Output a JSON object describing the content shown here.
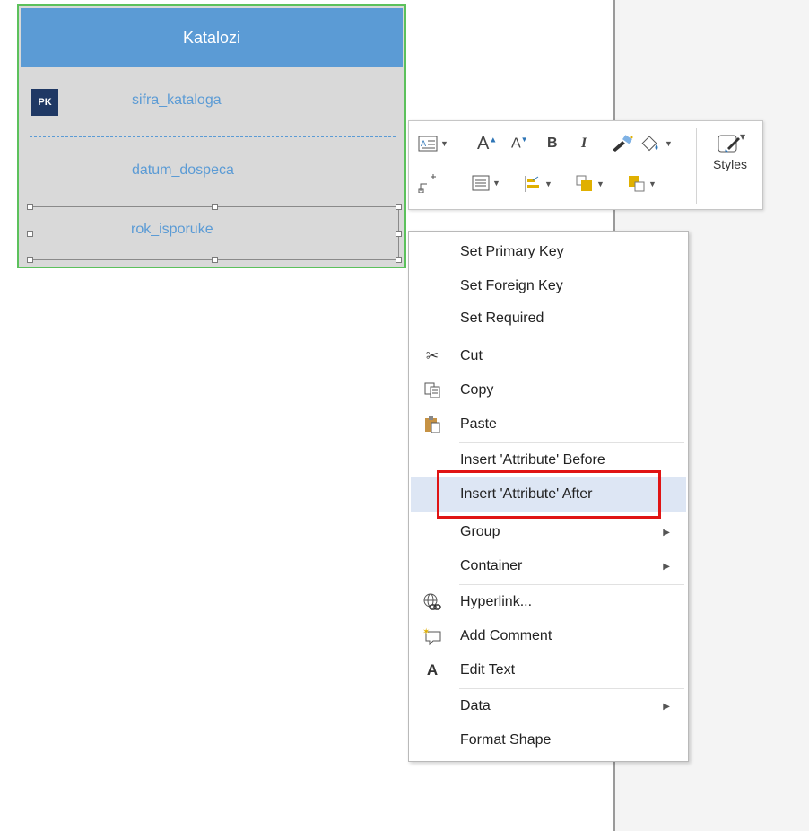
{
  "entity": {
    "title": "Katalozi",
    "pk_badge": "PK",
    "attributes": [
      "sifra_kataloga",
      "datum_dospeca",
      "rok_isporuke"
    ]
  },
  "toolbar": {
    "styles_label": "Styles"
  },
  "context_menu": {
    "items": [
      {
        "label": "Set Primary Key"
      },
      {
        "label": "Set Foreign Key"
      },
      {
        "label": "Set Required"
      },
      {
        "label": "Cut",
        "icon": "scissors-icon"
      },
      {
        "label": "Copy",
        "icon": "copy-icon"
      },
      {
        "label": "Paste",
        "icon": "paste-icon"
      },
      {
        "label": "Insert 'Attribute' Before"
      },
      {
        "label": "Insert 'Attribute' After"
      },
      {
        "label": "Group",
        "has_submenu": true
      },
      {
        "label": "Container",
        "has_submenu": true
      },
      {
        "label": "Hyperlink...",
        "icon": "hyperlink-icon"
      },
      {
        "label": "Add Comment",
        "icon": "add-comment-icon"
      },
      {
        "label": "Edit Text",
        "icon": "edit-text-icon",
        "icon_glyph": "A"
      },
      {
        "label": "Data",
        "has_submenu": true
      },
      {
        "label": "Format Shape"
      }
    ],
    "highlighted_item": "Insert 'Attribute' After"
  },
  "colors": {
    "entity_header": "#5b9bd5",
    "attribute_text": "#5b9bd5",
    "pk_badge": "#1f3864",
    "entity_border": "#5cc15c",
    "menu_hover": "#dde6f4",
    "annotation_box": "#e01414"
  }
}
